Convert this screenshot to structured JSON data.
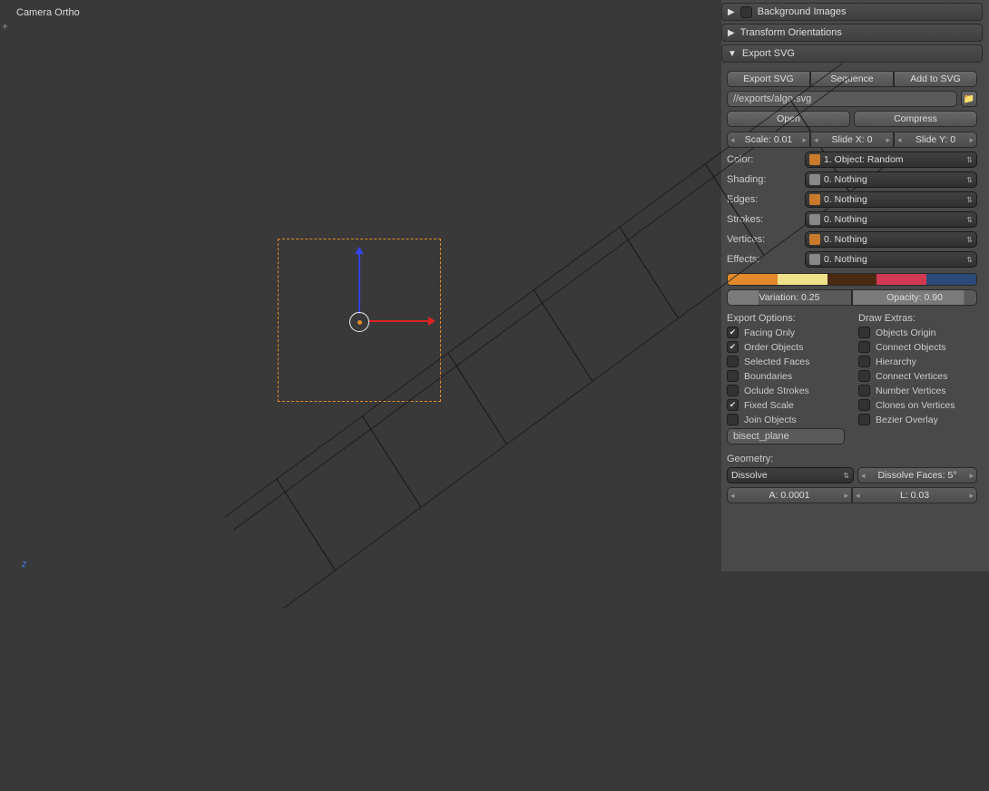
{
  "viewport": {
    "label": "Camera Ortho",
    "plus": "+",
    "axis": "z"
  },
  "panels": {
    "bg_images": "Background Images",
    "xform": "Transform Orientations",
    "export_svg": "Export SVG"
  },
  "export": {
    "buttons": {
      "export": "Export SVG",
      "sequence": "Sequence",
      "add": "Add to SVG"
    },
    "path": "//exports/algo.svg",
    "open": "Open",
    "compress": "Compress",
    "scale": "Scale: 0.01",
    "slidex": "Slide X: 0",
    "slidey": "Slide Y: 0",
    "color_lbl": "Color:",
    "color_val": "1. Object: Random",
    "shading_lbl": "Shading:",
    "shading_val": "0. Nothing",
    "edges_lbl": "Edges:",
    "edges_val": "0. Nothing",
    "strokes_lbl": "Strokes:",
    "strokes_val": "0. Nothing",
    "vertices_lbl": "Vertices:",
    "vertices_val": "0. Nothing",
    "effects_lbl": "Effects:",
    "effects_val": "0. Nothing",
    "swatches": [
      "#e28a2b",
      "#efe08a",
      "#4a2a10",
      "#d13a52",
      "#2b4a7a"
    ],
    "variation": "Variation: 0.25",
    "opacity": "Opacity: 0.90",
    "export_opts_hd": "Export Options:",
    "draw_extras_hd": "Draw Extras:",
    "opts_left": [
      {
        "label": "Facing Only",
        "on": true
      },
      {
        "label": "Order Objects",
        "on": true
      },
      {
        "label": "Selected Faces",
        "on": false
      },
      {
        "label": "Boundaries",
        "on": false
      },
      {
        "label": "Oclude Strokes",
        "on": false
      },
      {
        "label": "Fixed Scale",
        "on": true
      },
      {
        "label": "Join Objects",
        "on": false
      }
    ],
    "opts_right": [
      {
        "label": "Objects Origin",
        "on": false
      },
      {
        "label": "Connect Objects",
        "on": false
      },
      {
        "label": "Hierarchy",
        "on": false
      },
      {
        "label": "Connect Vertices",
        "on": false
      },
      {
        "label": "Number Vertices",
        "on": false
      },
      {
        "label": "Clones on Vertices",
        "on": false
      },
      {
        "label": "Bezier Overlay",
        "on": false
      }
    ],
    "bisect": "bisect_plane",
    "geometry_hd": "Geometry:",
    "dissolve": "Dissolve",
    "dissolve_faces": "Dissolve Faces: 5°",
    "a_val": "A: 0.0001",
    "l_val": "L: 0.03"
  }
}
